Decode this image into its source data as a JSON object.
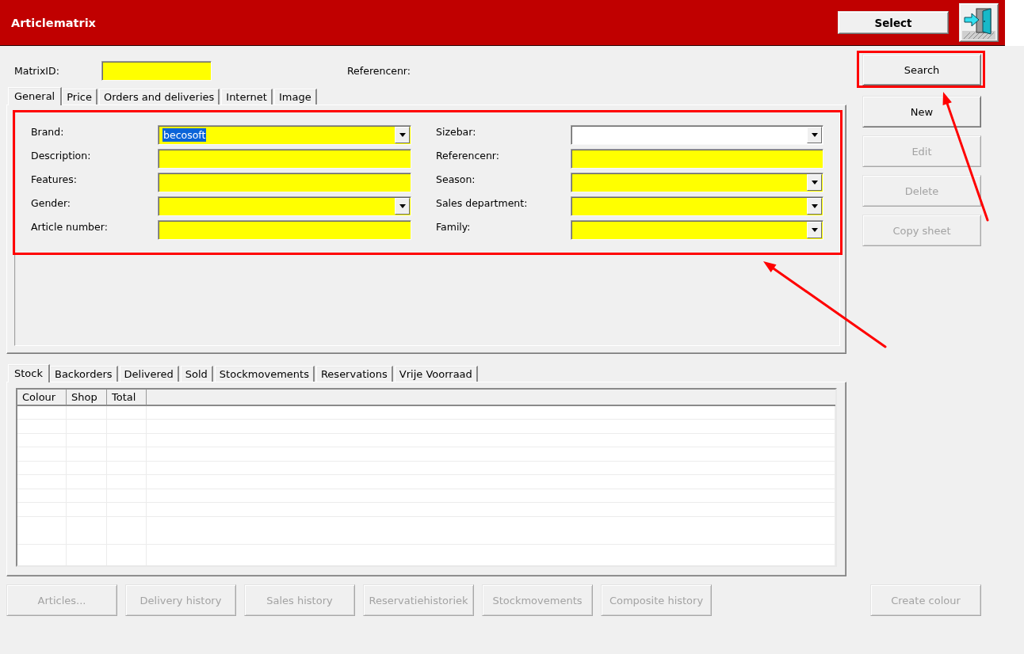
{
  "title_bar": {
    "title": "Articlematrix",
    "select_button": "Select"
  },
  "matrix_id": {
    "label": "MatrixID:",
    "color": "#ffff00"
  },
  "referencenr_label": "Referencenr:",
  "top_tabs": [
    {
      "label": "General",
      "selected": true
    },
    {
      "label": "Price",
      "selected": false
    },
    {
      "label": "Orders and deliveries",
      "selected": false
    },
    {
      "label": "Internet",
      "selected": false
    },
    {
      "label": "Image",
      "selected": false
    }
  ],
  "general": {
    "callout": true,
    "fields": [
      {
        "label": "Brand:",
        "kind": "combo",
        "value": "becosoft",
        "text_selected": true,
        "color": "#ffff00"
      },
      {
        "label": "Sizebar:",
        "kind": "combo",
        "color": "#ffffff"
      },
      {
        "label": "Description:",
        "kind": "text",
        "color": "#ffff00"
      },
      {
        "label": "Referencenr:",
        "kind": "text",
        "color": "#ffff00"
      },
      {
        "label": "Features:",
        "kind": "text",
        "color": "#ffff00"
      },
      {
        "label": "Season:",
        "kind": "combo",
        "color": "#ffff00"
      },
      {
        "label": "Gender:",
        "kind": "combo",
        "color": "#ffff00"
      },
      {
        "label": "Sales department:",
        "kind": "combo",
        "color": "#ffff00"
      },
      {
        "label": "Article number:",
        "kind": "text",
        "color": "#ffff00"
      },
      {
        "label": "Family:",
        "kind": "combo",
        "color": "#ffff00"
      }
    ]
  },
  "side_buttons": [
    {
      "label": "Search",
      "disabled": false,
      "callout": true
    },
    {
      "label": "New",
      "disabled": false,
      "callout": false
    },
    {
      "label": "Edit",
      "disabled": true,
      "callout": false
    },
    {
      "label": "Delete",
      "disabled": true,
      "callout": false
    },
    {
      "label": "Copy sheet",
      "disabled": true,
      "callout": false
    }
  ],
  "bottom_tabs": [
    {
      "label": "Stock",
      "selected": true
    },
    {
      "label": "Backorders",
      "selected": false
    },
    {
      "label": "Delivered",
      "selected": false
    },
    {
      "label": "Sold",
      "selected": false
    },
    {
      "label": "Stockmovements",
      "selected": false
    },
    {
      "label": "Reservations",
      "selected": false
    },
    {
      "label": "Vrije Voorraad",
      "selected": false
    }
  ],
  "stock_table": {
    "columns": [
      "Colour",
      "Shop",
      "Total"
    ]
  },
  "bottom_buttons": [
    {
      "label": "Articles...",
      "disabled": true
    },
    {
      "label": "Delivery history",
      "disabled": true
    },
    {
      "label": "Sales history",
      "disabled": true
    },
    {
      "label": "Reservatiehistoriek",
      "disabled": true
    },
    {
      "label": "Stockmovements",
      "disabled": true
    },
    {
      "label": "Composite history",
      "disabled": true
    }
  ],
  "create_colour_button": {
    "label": "Create colour",
    "disabled": true
  }
}
